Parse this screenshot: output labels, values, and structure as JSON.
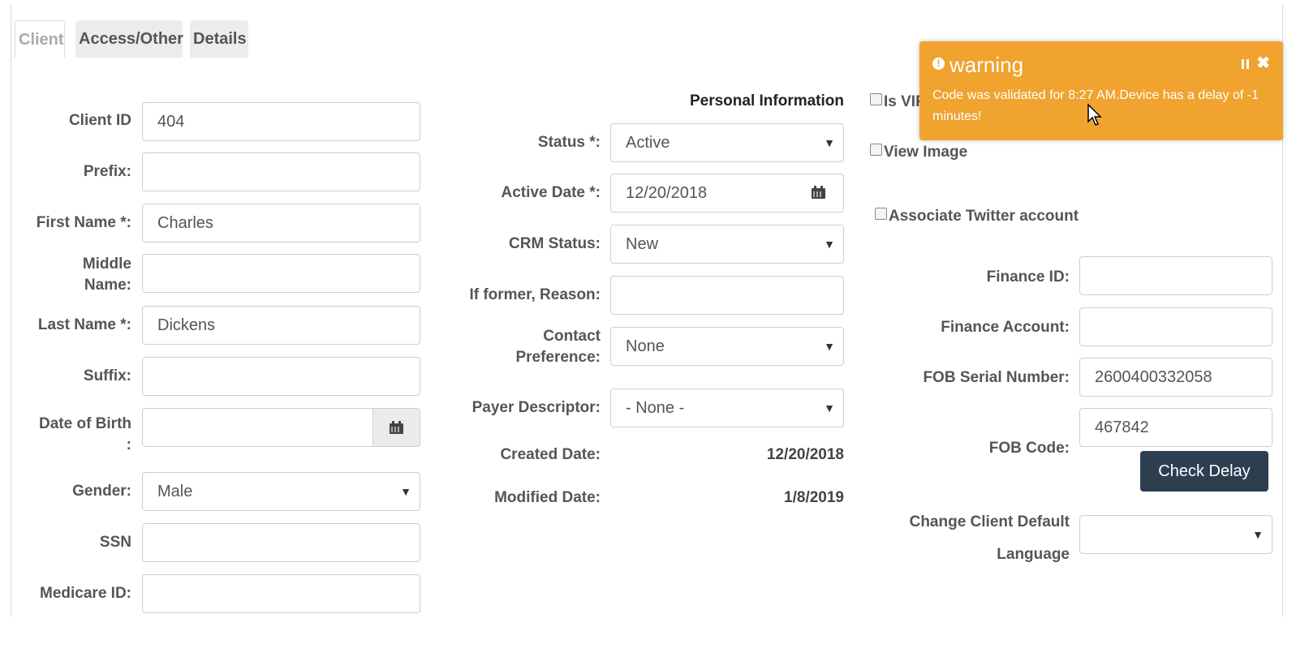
{
  "tabs": [
    "Client",
    "Access/Other",
    "Details"
  ],
  "left": {
    "client_id": {
      "label": "Client ID",
      "value": "404"
    },
    "prefix": {
      "label": "Prefix:",
      "value": ""
    },
    "first_name": {
      "label": "First Name *:",
      "value": "Charles"
    },
    "middle_name": {
      "label_1": "Middle",
      "label_2": "Name:",
      "value": ""
    },
    "last_name": {
      "label": "Last Name *:",
      "value": "Dickens"
    },
    "suffix": {
      "label": "Suffix:",
      "value": ""
    },
    "dob": {
      "label_1": "Date of Birth",
      "label_2": ":",
      "value": ""
    },
    "gender": {
      "label": "Gender:",
      "value": "Male"
    },
    "ssn": {
      "label": "SSN",
      "value": ""
    },
    "medicare": {
      "label": "Medicare ID:",
      "value": ""
    }
  },
  "middle": {
    "section_title": "Personal Information",
    "status": {
      "label": "Status *:",
      "value": "Active"
    },
    "active_date": {
      "label": "Active Date *:",
      "value": "12/20/2018"
    },
    "crm_status": {
      "label": "CRM Status:",
      "value": "New"
    },
    "former_reason": {
      "label": "If former, Reason:",
      "value": ""
    },
    "contact_pref": {
      "label_1": "Contact",
      "label_2": "Preference:",
      "value": "None"
    },
    "payer": {
      "label": "Payer Descriptor:",
      "value": "- None -"
    },
    "created": {
      "label": "Created Date:",
      "value": "12/20/2018"
    },
    "modified": {
      "label": "Modified Date:",
      "value": "1/8/2019"
    }
  },
  "right": {
    "is_vip": {
      "label": "Is VIP"
    },
    "view_image": {
      "label": "View Image"
    },
    "twitter": {
      "label": "Associate Twitter account"
    },
    "finance_id": {
      "label": "Finance ID:",
      "value": ""
    },
    "finance_account": {
      "label": "Finance Account:",
      "value": ""
    },
    "fob_serial": {
      "label": "FOB Serial Number:",
      "value": "2600400332058"
    },
    "fob_code": {
      "label": "FOB Code:",
      "value": "467842"
    },
    "check_delay": "Check Delay",
    "language": {
      "label_1": "Change Client Default",
      "label_2": "Language",
      "value": ""
    }
  },
  "toast": {
    "title": "warning",
    "message": "Code was validated for 8:27 AM.Device has a delay of -1 minutes!",
    "pause": "pause",
    "close": "✖"
  },
  "colors": {
    "toast_bg": "#f0a32e",
    "button_bg": "#2c3e50"
  }
}
